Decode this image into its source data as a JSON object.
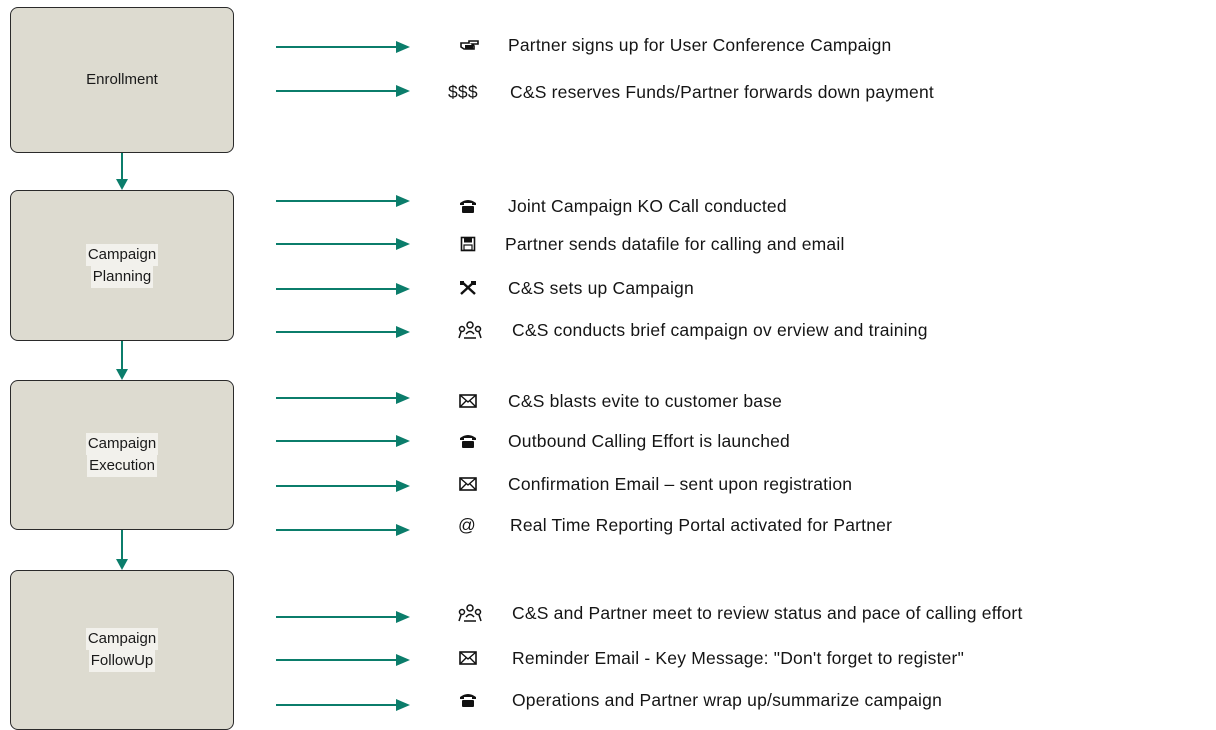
{
  "stages": [
    {
      "line1": "Enrollment",
      "line2": ""
    },
    {
      "line1": "Campaign",
      "line2": "Planning"
    },
    {
      "line1": "Campaign",
      "line2": "Execution"
    },
    {
      "line1": "Campaign",
      "line2": "FollowUp"
    }
  ],
  "steps": [
    {
      "icon": "pointing-hand-icon",
      "text": "Partner signs up for User Conference Campaign"
    },
    {
      "icon": "$$$",
      "text": "C&S reserves Funds/Partner forwards down payment"
    },
    {
      "icon": "telephone-icon",
      "text": "Joint Campaign KO Call conducted"
    },
    {
      "icon": "floppy-disk-icon",
      "text": "Partner sends datafile for calling and email"
    },
    {
      "icon": "tools-icon",
      "text": "C&S sets up Campaign"
    },
    {
      "icon": "meeting-people-icon",
      "text": "C&S conducts brief campaign ov erview and training"
    },
    {
      "icon": "envelope-icon",
      "text": "C&S blasts evite to customer base"
    },
    {
      "icon": "telephone-icon",
      "text": "Outbound Calling Effort is launched"
    },
    {
      "icon": "envelope-icon",
      "text": "Confirmation Email – sent upon registration"
    },
    {
      "icon": "@",
      "text": "Real Time Reporting Portal activated for Partner"
    },
    {
      "icon": "meeting-people-icon",
      "text": "C&S and Partner meet to review status and pace of calling effort"
    },
    {
      "icon": "envelope-icon",
      "text": "Reminder Email - Key Message:  \"Don't forget to register\""
    },
    {
      "icon": "telephone-icon",
      "text": "Operations and Partner wrap up/summarize campaign"
    }
  ],
  "colors": {
    "arrow": "#0b7d6b",
    "box_fill": "#dddbd0",
    "box_border": "#2a2a2a"
  }
}
